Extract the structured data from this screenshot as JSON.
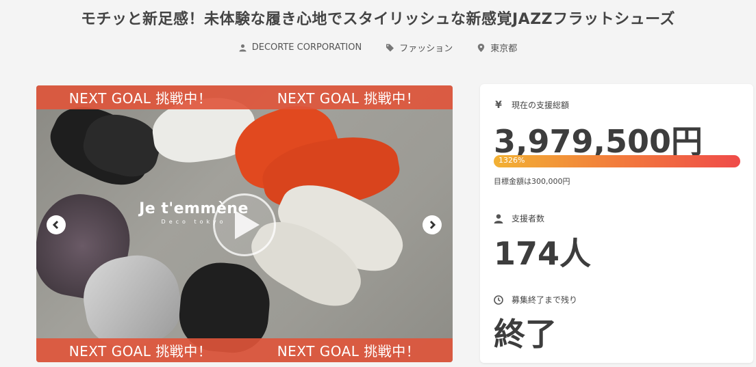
{
  "project": {
    "title": "モチッと新足感！未体験な履き心地でスタイリッシュな新感覚JAZZフラットシューズ",
    "owner": "DECORTE CORPORATION",
    "category": "ファッション",
    "location": "東京都"
  },
  "media": {
    "banner_text": "NEXT GOAL 挑戦中！",
    "logo_main": "Je t'emmène",
    "logo_sub": "Deco tokyo"
  },
  "stats": {
    "total_label": "現在の支援総額",
    "total_value": "3,979,500円",
    "yen_symbol": "¥",
    "progress_text": "1326%",
    "progress_percent": 1326,
    "goal_text": "目標金額は300,000円",
    "backers_label": "支援者数",
    "backers_value": "174人",
    "remaining_label": "募集終了まで残り",
    "remaining_value": "終了"
  },
  "icons": {
    "owner": "user-icon",
    "category": "tag-icon",
    "location": "map-marker-icon",
    "backers": "user-icon",
    "remaining": "clock-icon",
    "play": "play-icon"
  },
  "colors": {
    "banner": "#e0543a",
    "progress_start": "#f2b134",
    "progress_end": "#ef4b49"
  }
}
